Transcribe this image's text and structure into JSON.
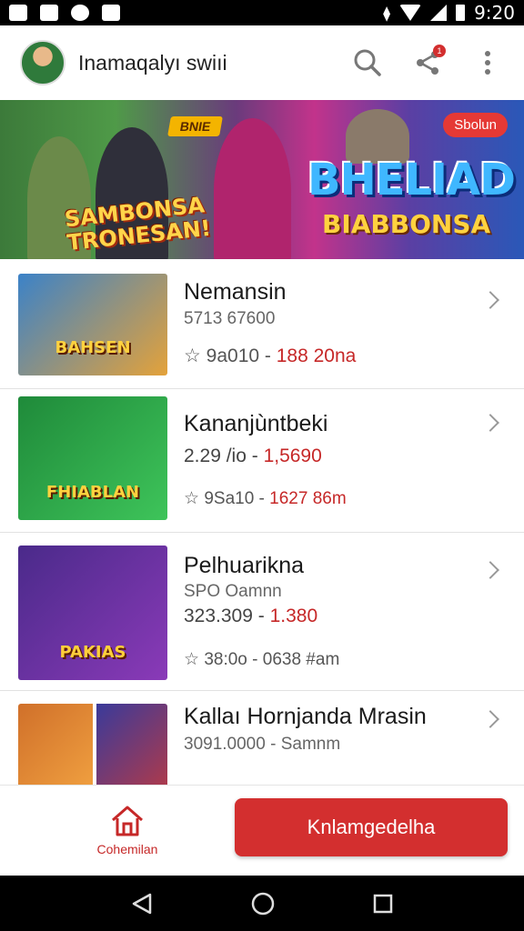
{
  "status_bar": {
    "time": "9:20",
    "icons": [
      "image-icon",
      "cat-icon",
      "refresh-icon",
      "notification-icon",
      "vibrate-icon",
      "wifi-icon",
      "signal-icon",
      "battery-icon"
    ]
  },
  "app_bar": {
    "title": "Inamaqalyı swiıi",
    "notification_count": "1"
  },
  "banner": {
    "tag": "BNIE",
    "badge": "Sbolun",
    "left_text": "SAMBONSA\nTRONESAN!",
    "title": "BHELIAD",
    "subtitle": "BIABBONSA",
    "colors": {
      "left": "#4f9a48",
      "middle": "#c2338b",
      "right": "#2a58b8"
    }
  },
  "items": [
    {
      "title": "Nemansin",
      "subtitle": "5713 67600",
      "meta_prefix": "9a010 -",
      "meta_value": "188 20na",
      "thumb_label": "BAHSEN",
      "thumb_colors": [
        "#3b82c8",
        "#e4a23a"
      ]
    },
    {
      "title": "Kananjùntbeki",
      "price_prefix": "2.29 /io -",
      "price_value": "1,5690",
      "meta_prefix": "9Sa10 -",
      "meta_value": "1627 86m",
      "thumb_label": "FHIABLAN",
      "thumb_colors": [
        "#1f8a3a",
        "#3ec45a"
      ]
    },
    {
      "title": "Pelhuarikna",
      "subtitle": "SPO Oamnn",
      "price_prefix": "323.309 -",
      "price_value": "1.380",
      "meta_prefix": "38:0o -",
      "meta_value": "0638 #am",
      "thumb_label": "PAKIAS",
      "thumb_colors": [
        "#4a2a8a",
        "#8a3ab8"
      ]
    },
    {
      "title": "Kallaı Hornjanda Mrasin",
      "subtitle": "3091.0000 - Samnm",
      "thumb_colors": [
        "#d0702a",
        "#3a3a9a"
      ]
    }
  ],
  "bottom_bar": {
    "home_label": "Cohemilan",
    "cta_label": "Knlamgedelha"
  }
}
